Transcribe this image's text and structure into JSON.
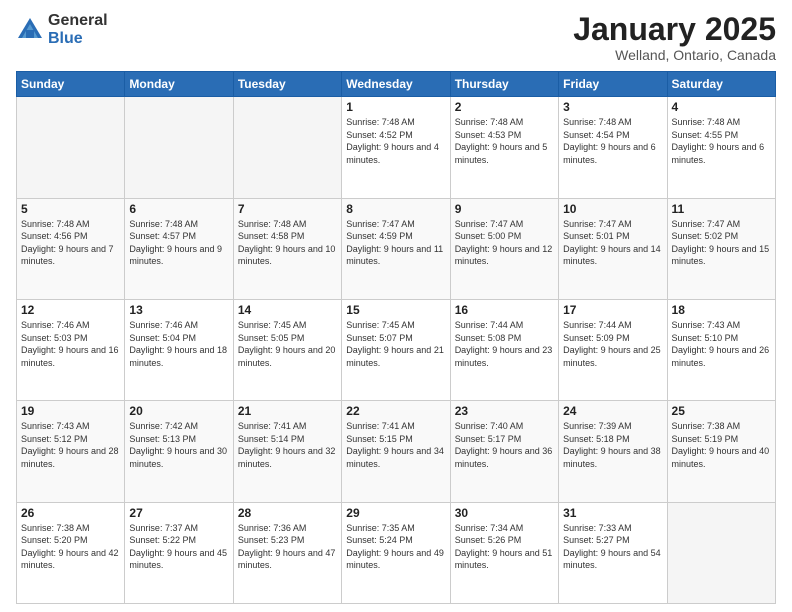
{
  "header": {
    "logo_general": "General",
    "logo_blue": "Blue",
    "month_title": "January 2025",
    "location": "Welland, Ontario, Canada"
  },
  "days_of_week": [
    "Sunday",
    "Monday",
    "Tuesday",
    "Wednesday",
    "Thursday",
    "Friday",
    "Saturday"
  ],
  "weeks": [
    [
      {
        "day": "",
        "info": ""
      },
      {
        "day": "",
        "info": ""
      },
      {
        "day": "",
        "info": ""
      },
      {
        "day": "1",
        "info": "Sunrise: 7:48 AM\nSunset: 4:52 PM\nDaylight: 9 hours and 4 minutes."
      },
      {
        "day": "2",
        "info": "Sunrise: 7:48 AM\nSunset: 4:53 PM\nDaylight: 9 hours and 5 minutes."
      },
      {
        "day": "3",
        "info": "Sunrise: 7:48 AM\nSunset: 4:54 PM\nDaylight: 9 hours and 6 minutes."
      },
      {
        "day": "4",
        "info": "Sunrise: 7:48 AM\nSunset: 4:55 PM\nDaylight: 9 hours and 6 minutes."
      }
    ],
    [
      {
        "day": "5",
        "info": "Sunrise: 7:48 AM\nSunset: 4:56 PM\nDaylight: 9 hours and 7 minutes."
      },
      {
        "day": "6",
        "info": "Sunrise: 7:48 AM\nSunset: 4:57 PM\nDaylight: 9 hours and 9 minutes."
      },
      {
        "day": "7",
        "info": "Sunrise: 7:48 AM\nSunset: 4:58 PM\nDaylight: 9 hours and 10 minutes."
      },
      {
        "day": "8",
        "info": "Sunrise: 7:47 AM\nSunset: 4:59 PM\nDaylight: 9 hours and 11 minutes."
      },
      {
        "day": "9",
        "info": "Sunrise: 7:47 AM\nSunset: 5:00 PM\nDaylight: 9 hours and 12 minutes."
      },
      {
        "day": "10",
        "info": "Sunrise: 7:47 AM\nSunset: 5:01 PM\nDaylight: 9 hours and 14 minutes."
      },
      {
        "day": "11",
        "info": "Sunrise: 7:47 AM\nSunset: 5:02 PM\nDaylight: 9 hours and 15 minutes."
      }
    ],
    [
      {
        "day": "12",
        "info": "Sunrise: 7:46 AM\nSunset: 5:03 PM\nDaylight: 9 hours and 16 minutes."
      },
      {
        "day": "13",
        "info": "Sunrise: 7:46 AM\nSunset: 5:04 PM\nDaylight: 9 hours and 18 minutes."
      },
      {
        "day": "14",
        "info": "Sunrise: 7:45 AM\nSunset: 5:05 PM\nDaylight: 9 hours and 20 minutes."
      },
      {
        "day": "15",
        "info": "Sunrise: 7:45 AM\nSunset: 5:07 PM\nDaylight: 9 hours and 21 minutes."
      },
      {
        "day": "16",
        "info": "Sunrise: 7:44 AM\nSunset: 5:08 PM\nDaylight: 9 hours and 23 minutes."
      },
      {
        "day": "17",
        "info": "Sunrise: 7:44 AM\nSunset: 5:09 PM\nDaylight: 9 hours and 25 minutes."
      },
      {
        "day": "18",
        "info": "Sunrise: 7:43 AM\nSunset: 5:10 PM\nDaylight: 9 hours and 26 minutes."
      }
    ],
    [
      {
        "day": "19",
        "info": "Sunrise: 7:43 AM\nSunset: 5:12 PM\nDaylight: 9 hours and 28 minutes."
      },
      {
        "day": "20",
        "info": "Sunrise: 7:42 AM\nSunset: 5:13 PM\nDaylight: 9 hours and 30 minutes."
      },
      {
        "day": "21",
        "info": "Sunrise: 7:41 AM\nSunset: 5:14 PM\nDaylight: 9 hours and 32 minutes."
      },
      {
        "day": "22",
        "info": "Sunrise: 7:41 AM\nSunset: 5:15 PM\nDaylight: 9 hours and 34 minutes."
      },
      {
        "day": "23",
        "info": "Sunrise: 7:40 AM\nSunset: 5:17 PM\nDaylight: 9 hours and 36 minutes."
      },
      {
        "day": "24",
        "info": "Sunrise: 7:39 AM\nSunset: 5:18 PM\nDaylight: 9 hours and 38 minutes."
      },
      {
        "day": "25",
        "info": "Sunrise: 7:38 AM\nSunset: 5:19 PM\nDaylight: 9 hours and 40 minutes."
      }
    ],
    [
      {
        "day": "26",
        "info": "Sunrise: 7:38 AM\nSunset: 5:20 PM\nDaylight: 9 hours and 42 minutes."
      },
      {
        "day": "27",
        "info": "Sunrise: 7:37 AM\nSunset: 5:22 PM\nDaylight: 9 hours and 45 minutes."
      },
      {
        "day": "28",
        "info": "Sunrise: 7:36 AM\nSunset: 5:23 PM\nDaylight: 9 hours and 47 minutes."
      },
      {
        "day": "29",
        "info": "Sunrise: 7:35 AM\nSunset: 5:24 PM\nDaylight: 9 hours and 49 minutes."
      },
      {
        "day": "30",
        "info": "Sunrise: 7:34 AM\nSunset: 5:26 PM\nDaylight: 9 hours and 51 minutes."
      },
      {
        "day": "31",
        "info": "Sunrise: 7:33 AM\nSunset: 5:27 PM\nDaylight: 9 hours and 54 minutes."
      },
      {
        "day": "",
        "info": ""
      }
    ]
  ]
}
